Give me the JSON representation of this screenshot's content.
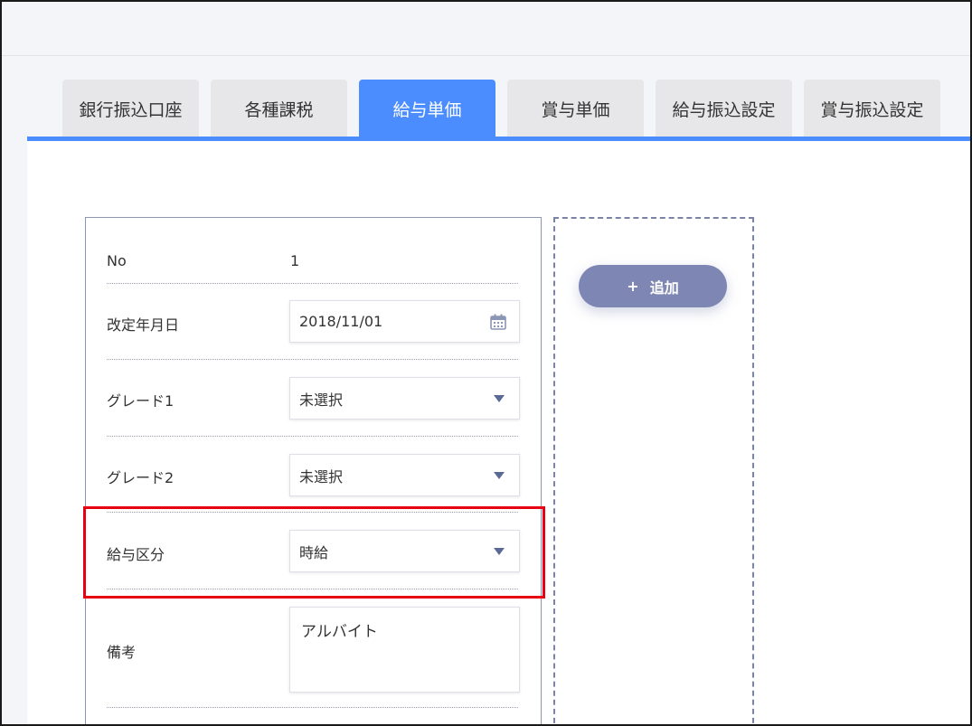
{
  "tabs": [
    {
      "label": "銀行振込口座"
    },
    {
      "label": "各種課税"
    },
    {
      "label": "給与単価"
    },
    {
      "label": "賞与単価"
    },
    {
      "label": "給与振込設定"
    },
    {
      "label": "賞与振込設定"
    }
  ],
  "active_tab": "給与単価",
  "form": {
    "no": {
      "label": "No",
      "value": "1"
    },
    "revision_date": {
      "label": "改定年月日",
      "value": "2018/11/01"
    },
    "grade1": {
      "label": "グレード1",
      "value": "未選択"
    },
    "grade2": {
      "label": "グレード2",
      "value": "未選択"
    },
    "pay_type": {
      "label": "給与区分",
      "value": "時給"
    },
    "remarks": {
      "label": "備考",
      "value": "アルバイト"
    }
  },
  "add_button": {
    "icon": "+",
    "label": "追加"
  },
  "colors": {
    "accent": "#4b8dff",
    "add_button": "#7e87b3",
    "highlight": "#e60012",
    "caret": "#5b6a94"
  }
}
